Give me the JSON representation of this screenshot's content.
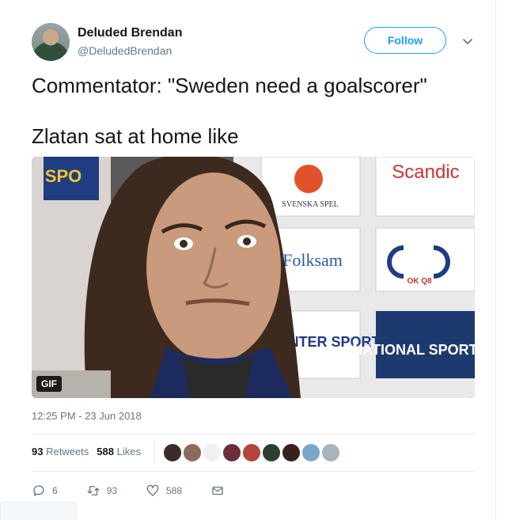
{
  "user": {
    "display_name": "Deluded Brendan",
    "handle": "@DeludedBrendan",
    "follow_label": "Follow"
  },
  "tweet": {
    "line1": "Commentator: \"Sweden need a goalscorer\"",
    "line2": "Zlatan sat at home like",
    "media_badge": "GIF",
    "media_sponsors": [
      "Scandic",
      "SVENSKA SPEL",
      "Folksam",
      "OK Q8",
      "INTER SPORT",
      "NATIONAL SPORTEN",
      "SPO"
    ],
    "timestamp": "12:25 PM - 23 Jun 2018"
  },
  "stats": {
    "retweets_count": "93",
    "retweets_label": "Retweets",
    "likes_count": "588",
    "likes_label": "Likes"
  },
  "likers": {
    "colors": [
      "#3b2b2b",
      "#8a6b5c",
      "#f0f0f0",
      "#6b2f3a",
      "#b5443b",
      "#2e3d32",
      "#3a1f1f",
      "#7aa7c7",
      "#a8b3bd"
    ]
  },
  "actions": {
    "reply_count": "6",
    "retweet_count": "93",
    "like_count": "588"
  },
  "colors": {
    "accent": "#1da1f2",
    "text_secondary": "#657786"
  }
}
